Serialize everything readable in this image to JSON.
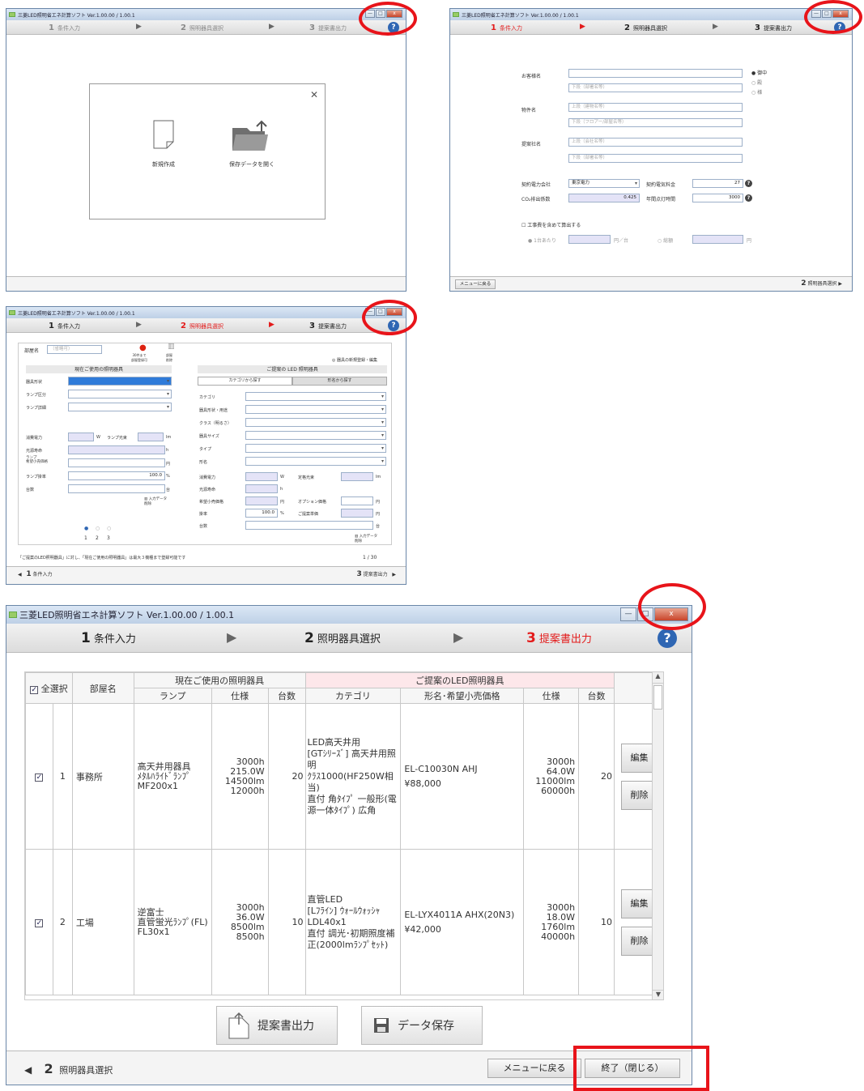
{
  "app_title": "三菱LED照明省エネ計算ソフト Ver.1.00.00 / 1.00.1",
  "window_controls": {
    "minimize": "—",
    "maximize": "□",
    "close": "x"
  },
  "steps": {
    "s1_num": "1",
    "s1": "条件入力",
    "s2_num": "2",
    "s2": "照明器具選択",
    "s3_num": "3",
    "s3": "提案書出力"
  },
  "help": "?",
  "panel1": {
    "close": "✕",
    "new": "新規作成",
    "open": "保存データを開く"
  },
  "panel2": {
    "customer": "お客様名",
    "hon": "御中",
    "dono": "殿",
    "sama": "様",
    "lower_dept": "下段（部署名等）",
    "property": "物件名",
    "upper_bldg": "上段（建物名等）",
    "lower_floor": "下段（フロアー/部屋名等）",
    "company": "提案社名",
    "upper_co": "上段（会社名等）",
    "power_co": "契約電力会社",
    "power_val": "東京電力",
    "rate": "契約電気料金",
    "rate_val": "27",
    "co2": "CO₂排出係数",
    "co2_val": "0.425",
    "hours": "年間点灯時間",
    "hours_val": "3000",
    "construct": "工事費を含めて算出する",
    "per_unit": "1台あたり",
    "yen_unit": "円／台",
    "total": "総額",
    "yen": "円",
    "menu": "メニューに戻る",
    "next_num": "2",
    "next": "照明器具選択"
  },
  "panel3": {
    "room": "部屋名",
    "room_ph": "（省略可）",
    "add": "30件まで\n部屋登録可",
    "del": "部屋\n削除",
    "fav": "器具の新規登録・編集",
    "current": "現在ご使用の照明器具",
    "proposed": "ご提案の LED 照明器具",
    "tab1": "カテゴリから探す",
    "tab2": "形名から探す",
    "left_labels": [
      "器具形状",
      "ランプ区分",
      "ランプ詳細"
    ],
    "power": "消費電力",
    "w": "W",
    "flux": "ランプ光束",
    "lm": "lm",
    "life": "光源寿命",
    "h": "h",
    "price": "ランプ\n希望小売価格",
    "yen": "円",
    "factor": "ランプ掛率",
    "factor_val": "100.0",
    "pct": "%",
    "count": "台数",
    "dai": "台",
    "clear": "入力データ\n削除",
    "right_labels": [
      "カテゴリ",
      "器具形状・用途",
      "クラス（明るさ）",
      "器具サイズ",
      "タイプ",
      "形名"
    ],
    "r_power": "消費電力",
    "r_flux": "定格光束",
    "r_life": "光源寿命",
    "r_price": "希望小売価格",
    "r_opt": "オプション価格",
    "r_factor": "掛率",
    "r_factor_val": "100.0",
    "r_unit": "ご提案単価",
    "r_count": "台数",
    "pages": [
      "1",
      "2",
      "3"
    ],
    "note": "「ご提案のLED照明器具」に対し、「現在ご使用の照明器具」は最大３機種まで登録可能です",
    "page_count": "1 / 30",
    "prev_num": "1",
    "prev": "条件入力",
    "next_num": "3",
    "next": "提案書出力"
  },
  "main": {
    "select_all": "全選択",
    "room_col": "部屋名",
    "current_hdr": "現在ご使用の照明器具",
    "proposed_hdr": "ご提案のLED照明器具",
    "cols": {
      "lamp": "ランプ",
      "spec": "仕様",
      "count": "台数",
      "category": "カテゴリ",
      "model": "形名･希望小売価格",
      "spec2": "仕様",
      "count2": "台数"
    },
    "rows": [
      {
        "check": "✓",
        "no": "1",
        "room": "事務所",
        "lamp": "高天井用器具\nﾒﾀﾙﾊﾗｲﾄﾞﾗﾝﾌﾟ\nMF200x1",
        "spec": "3000h\n215.0W\n14500lm\n12000h",
        "count": "20",
        "category": "LED高天井用\n[GTｼﾘｰｽﾞ] 高天井用照明\nｸﾗｽ1000(HF250W相当)\n直付 角ﾀｲﾌﾟ 一般形(電源一体ﾀｲﾌﾟ) 広角",
        "model": "EL-C10030N AHJ",
        "price": "¥88,000",
        "spec2": "3000h\n64.0W\n11000lm\n60000h",
        "count2": "20",
        "edit": "編集",
        "delete": "削除"
      },
      {
        "check": "✓",
        "no": "2",
        "room": "工場",
        "lamp": "逆富士\n直管蛍光ﾗﾝﾌﾟ(FL)\nFL30x1",
        "spec": "3000h\n36.0W\n8500lm\n8500h",
        "count": "10",
        "category": "直管LED\n[Lﾌﾗｲﾝ] ｳｫｰﾙｳｫｯｼｬ\nLDL40x1\n直付 調光･初期照度補正(2000lmﾗﾝﾌﾟｾｯﾄ)",
        "model": "EL-LYX4011A AHX(20N3)",
        "price": "¥42,000",
        "spec2": "3000h\n18.0W\n1760lm\n40000h",
        "count2": "10",
        "edit": "編集",
        "delete": "削除"
      }
    ],
    "output_btn": "提案書出力",
    "save_btn": "データ保存",
    "back_num": "2",
    "back": "照明器具選択",
    "menu": "メニューに戻る",
    "exit": "終了（閉じる）"
  }
}
